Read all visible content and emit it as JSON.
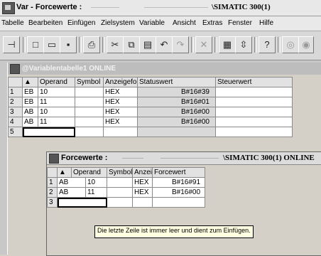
{
  "main_window": {
    "title": "Var - Forcewerte :",
    "station": "\\SIMATIC 300(1)"
  },
  "menu": [
    "Tabelle",
    "Bearbeiten",
    "Einfügen",
    "Zielsystem",
    "Variable",
    "Ansicht",
    "Extras",
    "Fenster",
    "Hilfe"
  ],
  "toolbar": [
    {
      "icon": "pin-icon",
      "glyph": "⊣"
    },
    {
      "icon": "new-document-icon",
      "glyph": "□"
    },
    {
      "icon": "open-folder-icon",
      "glyph": "▭"
    },
    {
      "icon": "save-icon",
      "glyph": "▪"
    },
    {
      "icon": "print-icon",
      "glyph": "⎙"
    },
    {
      "icon": "cut-icon",
      "glyph": "✂"
    },
    {
      "icon": "copy-icon",
      "glyph": "⧉"
    },
    {
      "icon": "paste-icon",
      "glyph": "▤"
    },
    {
      "icon": "undo-icon",
      "glyph": "↶"
    },
    {
      "icon": "redo-icon",
      "glyph": "↷"
    },
    {
      "icon": "delete-icon",
      "glyph": "✕"
    },
    {
      "icon": "monitor-icon",
      "glyph": "▦"
    },
    {
      "icon": "modify-icon",
      "glyph": "⇳"
    },
    {
      "icon": "help-icon",
      "glyph": "?"
    },
    {
      "icon": "monitor-variable-icon",
      "glyph": "◎"
    },
    {
      "icon": "modify-variable-icon",
      "glyph": "◉"
    }
  ],
  "var_table_window": {
    "title": "@Variablentabelle1  ONLINE",
    "columns": [
      "Operand",
      "Symbol",
      "Anzeigefor",
      "Statuswert",
      "Steuerwert"
    ],
    "rows": [
      {
        "num": "1",
        "operand": "EB",
        "address": "10",
        "symbol": "",
        "format": "HEX",
        "status": "B#16#39",
        "control": ""
      },
      {
        "num": "2",
        "operand": "EB",
        "address": "11",
        "symbol": "",
        "format": "HEX",
        "status": "B#16#01",
        "control": ""
      },
      {
        "num": "3",
        "operand": "AB",
        "address": "10",
        "symbol": "",
        "format": "HEX",
        "status": "B#16#00",
        "control": ""
      },
      {
        "num": "4",
        "operand": "AB",
        "address": "11",
        "symbol": "",
        "format": "HEX",
        "status": "B#16#00",
        "control": ""
      },
      {
        "num": "5",
        "operand": "",
        "address": "",
        "symbol": "",
        "format": "",
        "status": "",
        "control": ""
      }
    ]
  },
  "force_window": {
    "title": "Forcewerte :",
    "station": "\\SIMATIC 300(1)  ONLINE",
    "columns": [
      "Operand",
      "Symbol",
      "Anzei",
      "Forcewert"
    ],
    "rows": [
      {
        "num": "1",
        "operand": "AB",
        "address": "10",
        "symbol": "",
        "format": "HEX",
        "force": "B#16#91"
      },
      {
        "num": "2",
        "operand": "AB",
        "address": "11",
        "symbol": "",
        "format": "HEX",
        "force": "B#16#00"
      },
      {
        "num": "3",
        "operand": "",
        "address": "",
        "symbol": "",
        "format": "",
        "force": ""
      }
    ]
  },
  "tooltip": "Die letzte Zeile ist immer leer und dient zum Einfügen."
}
